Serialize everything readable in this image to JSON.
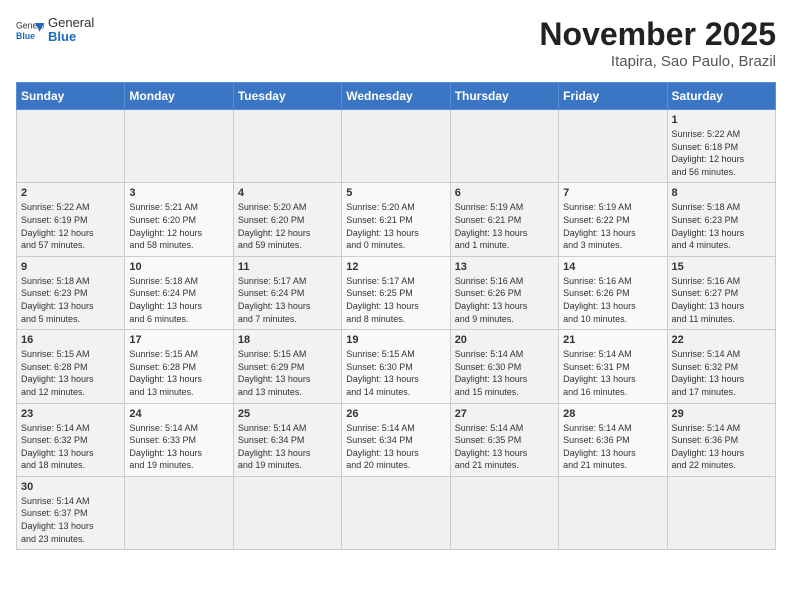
{
  "header": {
    "logo_general": "General",
    "logo_blue": "Blue",
    "title": "November 2025",
    "subtitle": "Itapira, Sao Paulo, Brazil"
  },
  "weekdays": [
    "Sunday",
    "Monday",
    "Tuesday",
    "Wednesday",
    "Thursday",
    "Friday",
    "Saturday"
  ],
  "weeks": [
    [
      {
        "day": "",
        "info": ""
      },
      {
        "day": "",
        "info": ""
      },
      {
        "day": "",
        "info": ""
      },
      {
        "day": "",
        "info": ""
      },
      {
        "day": "",
        "info": ""
      },
      {
        "day": "",
        "info": ""
      },
      {
        "day": "1",
        "info": "Sunrise: 5:22 AM\nSunset: 6:18 PM\nDaylight: 12 hours\nand 56 minutes."
      }
    ],
    [
      {
        "day": "2",
        "info": "Sunrise: 5:22 AM\nSunset: 6:19 PM\nDaylight: 12 hours\nand 57 minutes."
      },
      {
        "day": "3",
        "info": "Sunrise: 5:21 AM\nSunset: 6:20 PM\nDaylight: 12 hours\nand 58 minutes."
      },
      {
        "day": "4",
        "info": "Sunrise: 5:20 AM\nSunset: 6:20 PM\nDaylight: 12 hours\nand 59 minutes."
      },
      {
        "day": "5",
        "info": "Sunrise: 5:20 AM\nSunset: 6:21 PM\nDaylight: 13 hours\nand 0 minutes."
      },
      {
        "day": "6",
        "info": "Sunrise: 5:19 AM\nSunset: 6:21 PM\nDaylight: 13 hours\nand 1 minute."
      },
      {
        "day": "7",
        "info": "Sunrise: 5:19 AM\nSunset: 6:22 PM\nDaylight: 13 hours\nand 3 minutes."
      },
      {
        "day": "8",
        "info": "Sunrise: 5:18 AM\nSunset: 6:23 PM\nDaylight: 13 hours\nand 4 minutes."
      }
    ],
    [
      {
        "day": "9",
        "info": "Sunrise: 5:18 AM\nSunset: 6:23 PM\nDaylight: 13 hours\nand 5 minutes."
      },
      {
        "day": "10",
        "info": "Sunrise: 5:18 AM\nSunset: 6:24 PM\nDaylight: 13 hours\nand 6 minutes."
      },
      {
        "day": "11",
        "info": "Sunrise: 5:17 AM\nSunset: 6:24 PM\nDaylight: 13 hours\nand 7 minutes."
      },
      {
        "day": "12",
        "info": "Sunrise: 5:17 AM\nSunset: 6:25 PM\nDaylight: 13 hours\nand 8 minutes."
      },
      {
        "day": "13",
        "info": "Sunrise: 5:16 AM\nSunset: 6:26 PM\nDaylight: 13 hours\nand 9 minutes."
      },
      {
        "day": "14",
        "info": "Sunrise: 5:16 AM\nSunset: 6:26 PM\nDaylight: 13 hours\nand 10 minutes."
      },
      {
        "day": "15",
        "info": "Sunrise: 5:16 AM\nSunset: 6:27 PM\nDaylight: 13 hours\nand 11 minutes."
      }
    ],
    [
      {
        "day": "16",
        "info": "Sunrise: 5:15 AM\nSunset: 6:28 PM\nDaylight: 13 hours\nand 12 minutes."
      },
      {
        "day": "17",
        "info": "Sunrise: 5:15 AM\nSunset: 6:28 PM\nDaylight: 13 hours\nand 13 minutes."
      },
      {
        "day": "18",
        "info": "Sunrise: 5:15 AM\nSunset: 6:29 PM\nDaylight: 13 hours\nand 13 minutes."
      },
      {
        "day": "19",
        "info": "Sunrise: 5:15 AM\nSunset: 6:30 PM\nDaylight: 13 hours\nand 14 minutes."
      },
      {
        "day": "20",
        "info": "Sunrise: 5:14 AM\nSunset: 6:30 PM\nDaylight: 13 hours\nand 15 minutes."
      },
      {
        "day": "21",
        "info": "Sunrise: 5:14 AM\nSunset: 6:31 PM\nDaylight: 13 hours\nand 16 minutes."
      },
      {
        "day": "22",
        "info": "Sunrise: 5:14 AM\nSunset: 6:32 PM\nDaylight: 13 hours\nand 17 minutes."
      }
    ],
    [
      {
        "day": "23",
        "info": "Sunrise: 5:14 AM\nSunset: 6:32 PM\nDaylight: 13 hours\nand 18 minutes."
      },
      {
        "day": "24",
        "info": "Sunrise: 5:14 AM\nSunset: 6:33 PM\nDaylight: 13 hours\nand 19 minutes."
      },
      {
        "day": "25",
        "info": "Sunrise: 5:14 AM\nSunset: 6:34 PM\nDaylight: 13 hours\nand 19 minutes."
      },
      {
        "day": "26",
        "info": "Sunrise: 5:14 AM\nSunset: 6:34 PM\nDaylight: 13 hours\nand 20 minutes."
      },
      {
        "day": "27",
        "info": "Sunrise: 5:14 AM\nSunset: 6:35 PM\nDaylight: 13 hours\nand 21 minutes."
      },
      {
        "day": "28",
        "info": "Sunrise: 5:14 AM\nSunset: 6:36 PM\nDaylight: 13 hours\nand 21 minutes."
      },
      {
        "day": "29",
        "info": "Sunrise: 5:14 AM\nSunset: 6:36 PM\nDaylight: 13 hours\nand 22 minutes."
      }
    ],
    [
      {
        "day": "30",
        "info": "Sunrise: 5:14 AM\nSunset: 6:37 PM\nDaylight: 13 hours\nand 23 minutes."
      },
      {
        "day": "",
        "info": ""
      },
      {
        "day": "",
        "info": ""
      },
      {
        "day": "",
        "info": ""
      },
      {
        "day": "",
        "info": ""
      },
      {
        "day": "",
        "info": ""
      },
      {
        "day": "",
        "info": ""
      }
    ]
  ]
}
